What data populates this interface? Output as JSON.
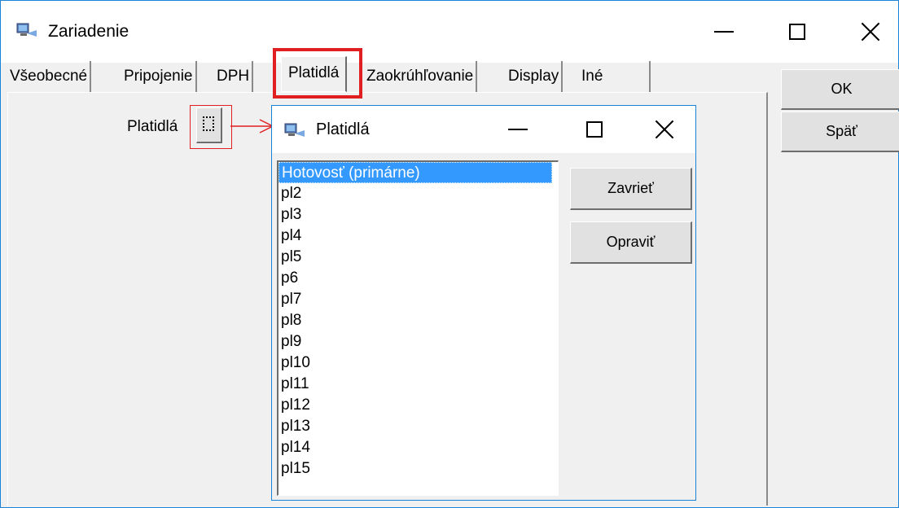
{
  "window": {
    "title": "Zariadenie",
    "icon": "monitor-network-icon"
  },
  "tabs": [
    {
      "label": "Všeobecné"
    },
    {
      "label": "Pripojenie"
    },
    {
      "label": "DPH"
    },
    {
      "label": "Platidlá"
    },
    {
      "label": "Zaokrúhľovanie"
    },
    {
      "label": "Display"
    },
    {
      "label": "Iné"
    }
  ],
  "selected_tab": "Platidlá",
  "buttons": {
    "ok": "OK",
    "back": "Späť"
  },
  "panel": {
    "platidla_label": "Platidlá",
    "picker_icon": "dotted-select-icon"
  },
  "annotation": {
    "color": "#e02020"
  },
  "dialog": {
    "title": "Platidlá",
    "icon": "monitor-network-icon",
    "close_button": "Zavrieť",
    "edit_button": "Opraviť",
    "items": [
      {
        "label": "Hotovosť (primárne)",
        "selected": true
      },
      {
        "label": "pl2"
      },
      {
        "label": "pl3"
      },
      {
        "label": "pl4"
      },
      {
        "label": "pl5"
      },
      {
        "label": "p6"
      },
      {
        "label": "pl7"
      },
      {
        "label": "pl8"
      },
      {
        "label": "pl9"
      },
      {
        "label": "pl10"
      },
      {
        "label": "pl11"
      },
      {
        "label": "pl12"
      },
      {
        "label": "pl13"
      },
      {
        "label": "pl14"
      },
      {
        "label": "pl15"
      }
    ]
  },
  "colors": {
    "selection": "#3399ff",
    "window_border": "#1883d7"
  }
}
